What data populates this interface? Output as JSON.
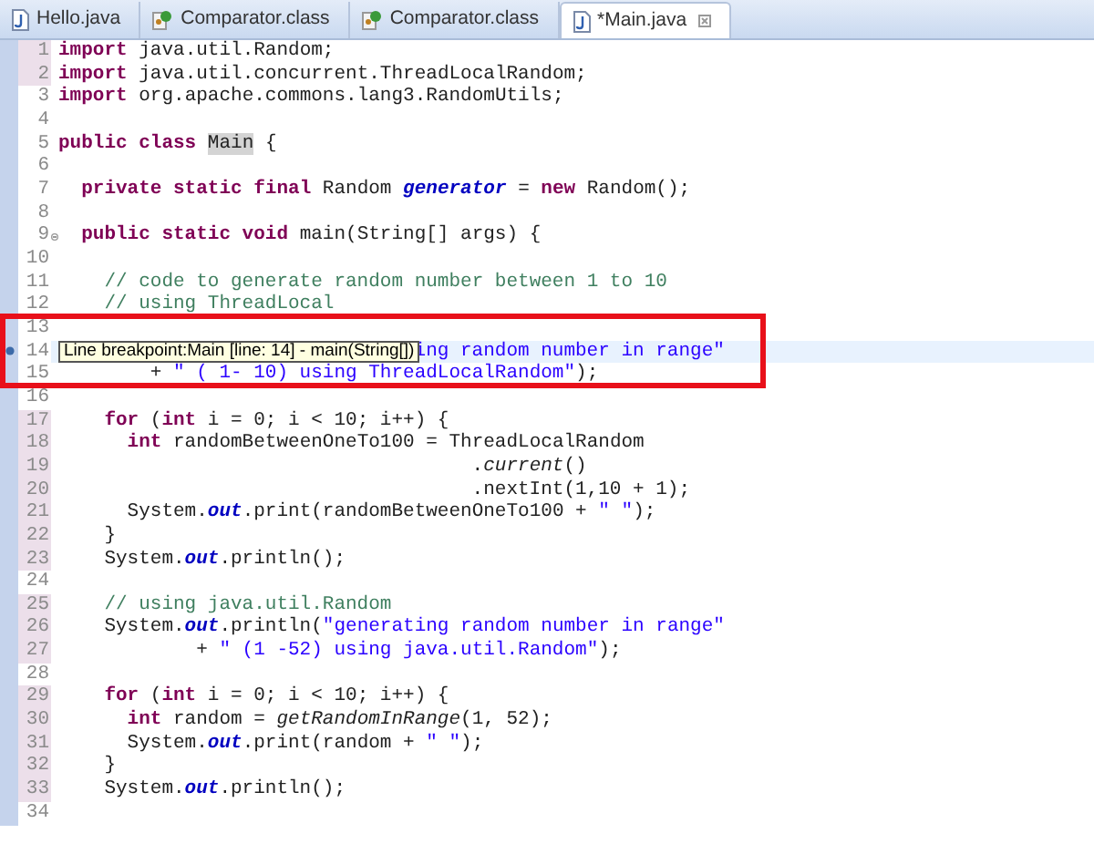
{
  "tabs": [
    {
      "label": "Hello.java",
      "kind": "java",
      "selected": false
    },
    {
      "label": "Comparator.class",
      "kind": "class",
      "selected": false
    },
    {
      "label": "Comparator.class",
      "kind": "class",
      "selected": false
    },
    {
      "label": "*Main.java",
      "kind": "java",
      "selected": true
    }
  ],
  "lines": [
    {
      "number": "1",
      "changed": true,
      "current": false,
      "breakpoint": false,
      "folding": false,
      "code": [
        {
          "text": "import",
          "kind": "kw"
        },
        {
          "text": " java.util.Random;",
          "kind": "p"
        }
      ]
    },
    {
      "number": "2",
      "changed": true,
      "current": false,
      "breakpoint": false,
      "folding": false,
      "code": [
        {
          "text": "import",
          "kind": "kw"
        },
        {
          "text": " java.util.concurrent.ThreadLocalRandom;",
          "kind": "p"
        }
      ]
    },
    {
      "number": "3",
      "changed": false,
      "current": false,
      "breakpoint": false,
      "folding": false,
      "code": [
        {
          "text": "import",
          "kind": "kw"
        },
        {
          "text": " org.apache.commons.lang3.RandomUtils;",
          "kind": "p"
        }
      ]
    },
    {
      "number": "4",
      "changed": false,
      "current": false,
      "breakpoint": false,
      "folding": false
    },
    {
      "number": "5",
      "changed": false,
      "current": false,
      "breakpoint": false,
      "folding": false,
      "code": [
        {
          "text": "public class ",
          "kind": "kw"
        },
        {
          "text": "Main",
          "kind": "hl"
        },
        {
          "text": " {",
          "kind": "p"
        }
      ]
    },
    {
      "number": "6",
      "changed": false,
      "current": false,
      "breakpoint": false,
      "folding": false
    },
    {
      "number": "7",
      "changed": false,
      "current": false,
      "breakpoint": false,
      "folding": false,
      "code": [
        {
          "text": "  private static final",
          "kind": "kw"
        },
        {
          "text": " Random ",
          "kind": "p"
        },
        {
          "text": "generator",
          "kind": "field"
        },
        {
          "text": " = ",
          "kind": "p"
        },
        {
          "text": "new",
          "kind": "kw"
        },
        {
          "text": " Random();",
          "kind": "p"
        }
      ]
    },
    {
      "number": "8",
      "changed": false,
      "current": false,
      "breakpoint": false,
      "folding": false
    },
    {
      "number": "9",
      "changed": false,
      "current": false,
      "breakpoint": false,
      "folding": true,
      "code": [
        {
          "text": "  public static void",
          "kind": "kw"
        },
        {
          "text": " main(String[] args) {",
          "kind": "p"
        }
      ]
    },
    {
      "number": "10",
      "changed": false,
      "current": false,
      "breakpoint": false,
      "folding": false
    },
    {
      "number": "11",
      "changed": false,
      "current": false,
      "breakpoint": false,
      "folding": false,
      "code": [
        {
          "text": "    // code to generate random number between 1 to 10",
          "kind": "com"
        }
      ]
    },
    {
      "number": "12",
      "changed": false,
      "current": false,
      "breakpoint": false,
      "folding": false,
      "code": [
        {
          "text": "    // using ThreadLocal",
          "kind": "com"
        }
      ]
    },
    {
      "number": "13",
      "changed": false,
      "current": false,
      "breakpoint": false,
      "folding": false
    },
    {
      "number": "14",
      "changed": false,
      "current": true,
      "breakpoint": true,
      "folding": false,
      "tooltip": "Line breakpoint:Main [line: 14] - main(String[])",
      "code": [
        {
          "text": "                               ing random number in range\"",
          "kind": "str"
        }
      ]
    },
    {
      "number": "15",
      "changed": false,
      "current": false,
      "breakpoint": false,
      "folding": false,
      "code": [
        {
          "text": "        + ",
          "kind": "p"
        },
        {
          "text": "\" ( 1- 10) using ThreadLocalRandom\"",
          "kind": "str"
        },
        {
          "text": ");",
          "kind": "p"
        }
      ]
    },
    {
      "number": "16",
      "changed": false,
      "current": false,
      "breakpoint": false,
      "folding": false
    },
    {
      "number": "17",
      "changed": true,
      "current": false,
      "breakpoint": false,
      "folding": false,
      "code": [
        {
          "text": "    for",
          "kind": "kw"
        },
        {
          "text": " (",
          "kind": "p"
        },
        {
          "text": "int",
          "kind": "kw"
        },
        {
          "text": " i = 0; i < 10; i++) {",
          "kind": "p"
        }
      ]
    },
    {
      "number": "18",
      "changed": true,
      "current": false,
      "breakpoint": false,
      "folding": false,
      "code": [
        {
          "text": "      int",
          "kind": "kw"
        },
        {
          "text": " randomBetweenOneTo100 = ThreadLocalRandom",
          "kind": "p"
        }
      ]
    },
    {
      "number": "19",
      "changed": true,
      "current": false,
      "breakpoint": false,
      "folding": false,
      "code": [
        {
          "text": "                                    .",
          "kind": "p"
        },
        {
          "text": "current",
          "kind": "method"
        },
        {
          "text": "()",
          "kind": "p"
        }
      ]
    },
    {
      "number": "20",
      "changed": true,
      "current": false,
      "breakpoint": false,
      "folding": false,
      "code": [
        {
          "text": "                                    .nextInt(1,10 + 1);",
          "kind": "p"
        }
      ]
    },
    {
      "number": "21",
      "changed": true,
      "current": false,
      "breakpoint": false,
      "folding": false,
      "code": [
        {
          "text": "      System.",
          "kind": "p"
        },
        {
          "text": "out",
          "kind": "field"
        },
        {
          "text": ".print(randomBetweenOneTo100 + ",
          "kind": "p"
        },
        {
          "text": "\" \"",
          "kind": "str"
        },
        {
          "text": ");",
          "kind": "p"
        }
      ]
    },
    {
      "number": "22",
      "changed": true,
      "current": false,
      "breakpoint": false,
      "folding": false,
      "code": [
        {
          "text": "    }",
          "kind": "p"
        }
      ]
    },
    {
      "number": "23",
      "changed": true,
      "current": false,
      "breakpoint": false,
      "folding": false,
      "code": [
        {
          "text": "    System.",
          "kind": "p"
        },
        {
          "text": "out",
          "kind": "field"
        },
        {
          "text": ".println();",
          "kind": "p"
        }
      ]
    },
    {
      "number": "24",
      "changed": false,
      "current": false,
      "breakpoint": false,
      "folding": false
    },
    {
      "number": "25",
      "changed": true,
      "current": false,
      "breakpoint": false,
      "folding": false,
      "code": [
        {
          "text": "    // using java.util.Random",
          "kind": "com"
        }
      ]
    },
    {
      "number": "26",
      "changed": true,
      "current": false,
      "breakpoint": false,
      "folding": false,
      "code": [
        {
          "text": "    System.",
          "kind": "p"
        },
        {
          "text": "out",
          "kind": "field"
        },
        {
          "text": ".println(",
          "kind": "p"
        },
        {
          "text": "\"generating random number in range\"",
          "kind": "str"
        }
      ]
    },
    {
      "number": "27",
      "changed": true,
      "current": false,
      "breakpoint": false,
      "folding": false,
      "code": [
        {
          "text": "            + ",
          "kind": "p"
        },
        {
          "text": "\" (1 -52) using java.util.Random\"",
          "kind": "str"
        },
        {
          "text": ");",
          "kind": "p"
        }
      ]
    },
    {
      "number": "28",
      "changed": false,
      "current": false,
      "breakpoint": false,
      "folding": false
    },
    {
      "number": "29",
      "changed": true,
      "current": false,
      "breakpoint": false,
      "folding": false,
      "code": [
        {
          "text": "    for",
          "kind": "kw"
        },
        {
          "text": " (",
          "kind": "p"
        },
        {
          "text": "int",
          "kind": "kw"
        },
        {
          "text": " i = 0; i < 10; i++) {",
          "kind": "p"
        }
      ]
    },
    {
      "number": "30",
      "changed": true,
      "current": false,
      "breakpoint": false,
      "folding": false,
      "code": [
        {
          "text": "      int",
          "kind": "kw"
        },
        {
          "text": " random = ",
          "kind": "p"
        },
        {
          "text": "getRandomInRange",
          "kind": "method"
        },
        {
          "text": "(1, 52);",
          "kind": "p"
        }
      ]
    },
    {
      "number": "31",
      "changed": true,
      "current": false,
      "breakpoint": false,
      "folding": false,
      "code": [
        {
          "text": "      System.",
          "kind": "p"
        },
        {
          "text": "out",
          "kind": "field"
        },
        {
          "text": ".print(random + ",
          "kind": "p"
        },
        {
          "text": "\" \"",
          "kind": "str"
        },
        {
          "text": ");",
          "kind": "p"
        }
      ]
    },
    {
      "number": "32",
      "changed": true,
      "current": false,
      "breakpoint": false,
      "folding": false,
      "code": [
        {
          "text": "    }",
          "kind": "p"
        }
      ]
    },
    {
      "number": "33",
      "changed": true,
      "current": false,
      "breakpoint": false,
      "folding": false,
      "code": [
        {
          "text": "    System.",
          "kind": "p"
        },
        {
          "text": "out",
          "kind": "field"
        },
        {
          "text": ".println();",
          "kind": "p"
        }
      ]
    },
    {
      "number": "34",
      "changed": false,
      "current": false,
      "breakpoint": false,
      "folding": false
    }
  ]
}
